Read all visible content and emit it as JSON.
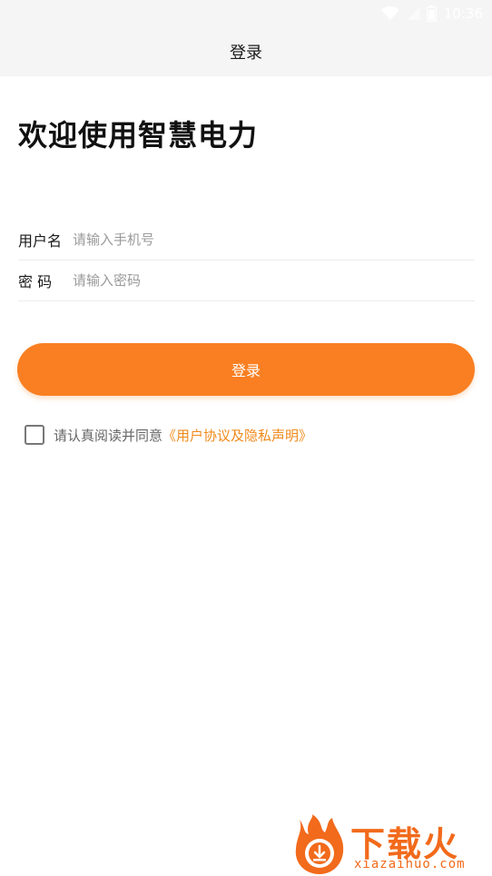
{
  "status_bar": {
    "time": "10:36",
    "icons": [
      "wifi-icon",
      "signal-icon",
      "battery-icon"
    ],
    "color": "#ffffff"
  },
  "nav": {
    "title": "登录"
  },
  "welcome": {
    "title": "欢迎使用智慧电力"
  },
  "form": {
    "username": {
      "label": "用户名",
      "placeholder": "请输入手机号",
      "value": ""
    },
    "password": {
      "label": "密 码",
      "placeholder": "请输入密码",
      "value": ""
    }
  },
  "login_button": {
    "label": "登录",
    "color": "#f97f22"
  },
  "agreement": {
    "checked": false,
    "text": "请认真阅读并同意",
    "link": "《用户协议及隐私声明》",
    "link_color": "#f08a1c"
  },
  "watermark": {
    "brand": "下载火",
    "domain": "xiazaihuo.com",
    "icon": "flame-download-icon",
    "color": "#f26a1b"
  }
}
